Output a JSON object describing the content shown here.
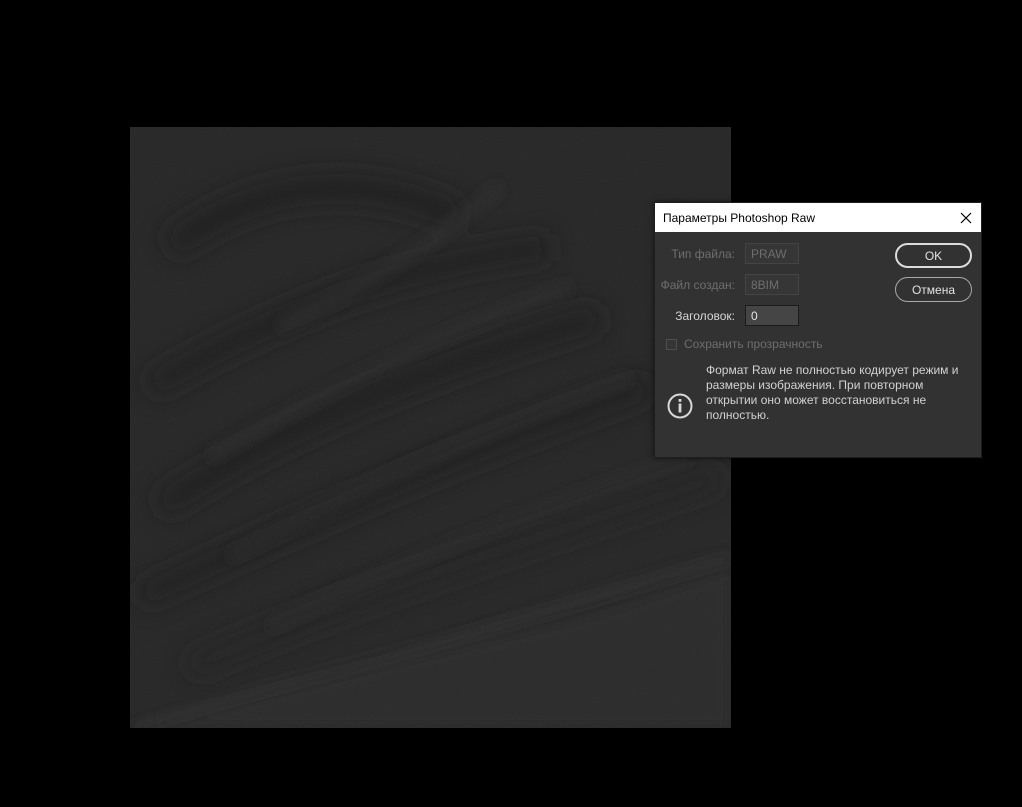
{
  "dialog": {
    "title": "Параметры Photoshop Raw",
    "close_icon": "close-icon",
    "fields": {
      "file_type": {
        "label": "Тип файла:",
        "value": "PRAW"
      },
      "creator": {
        "label": "Файл создан:",
        "value": "8BIM"
      },
      "header": {
        "label": "Заголовок:",
        "value": "0"
      }
    },
    "ok_label": "OK",
    "cancel_label": "Отмена",
    "save_transparency_label": "Сохранить прозрачность",
    "info_icon": "info-icon",
    "info_text": "Формат Raw не полностью кодирует режим и размеры изображения. При повторном открытии оно может восстановиться не полностью."
  },
  "colors": {
    "background": "#000000",
    "dialog_bg": "#323232",
    "titlebar_bg": "#ffffff",
    "canvas_bg": "#262626"
  }
}
